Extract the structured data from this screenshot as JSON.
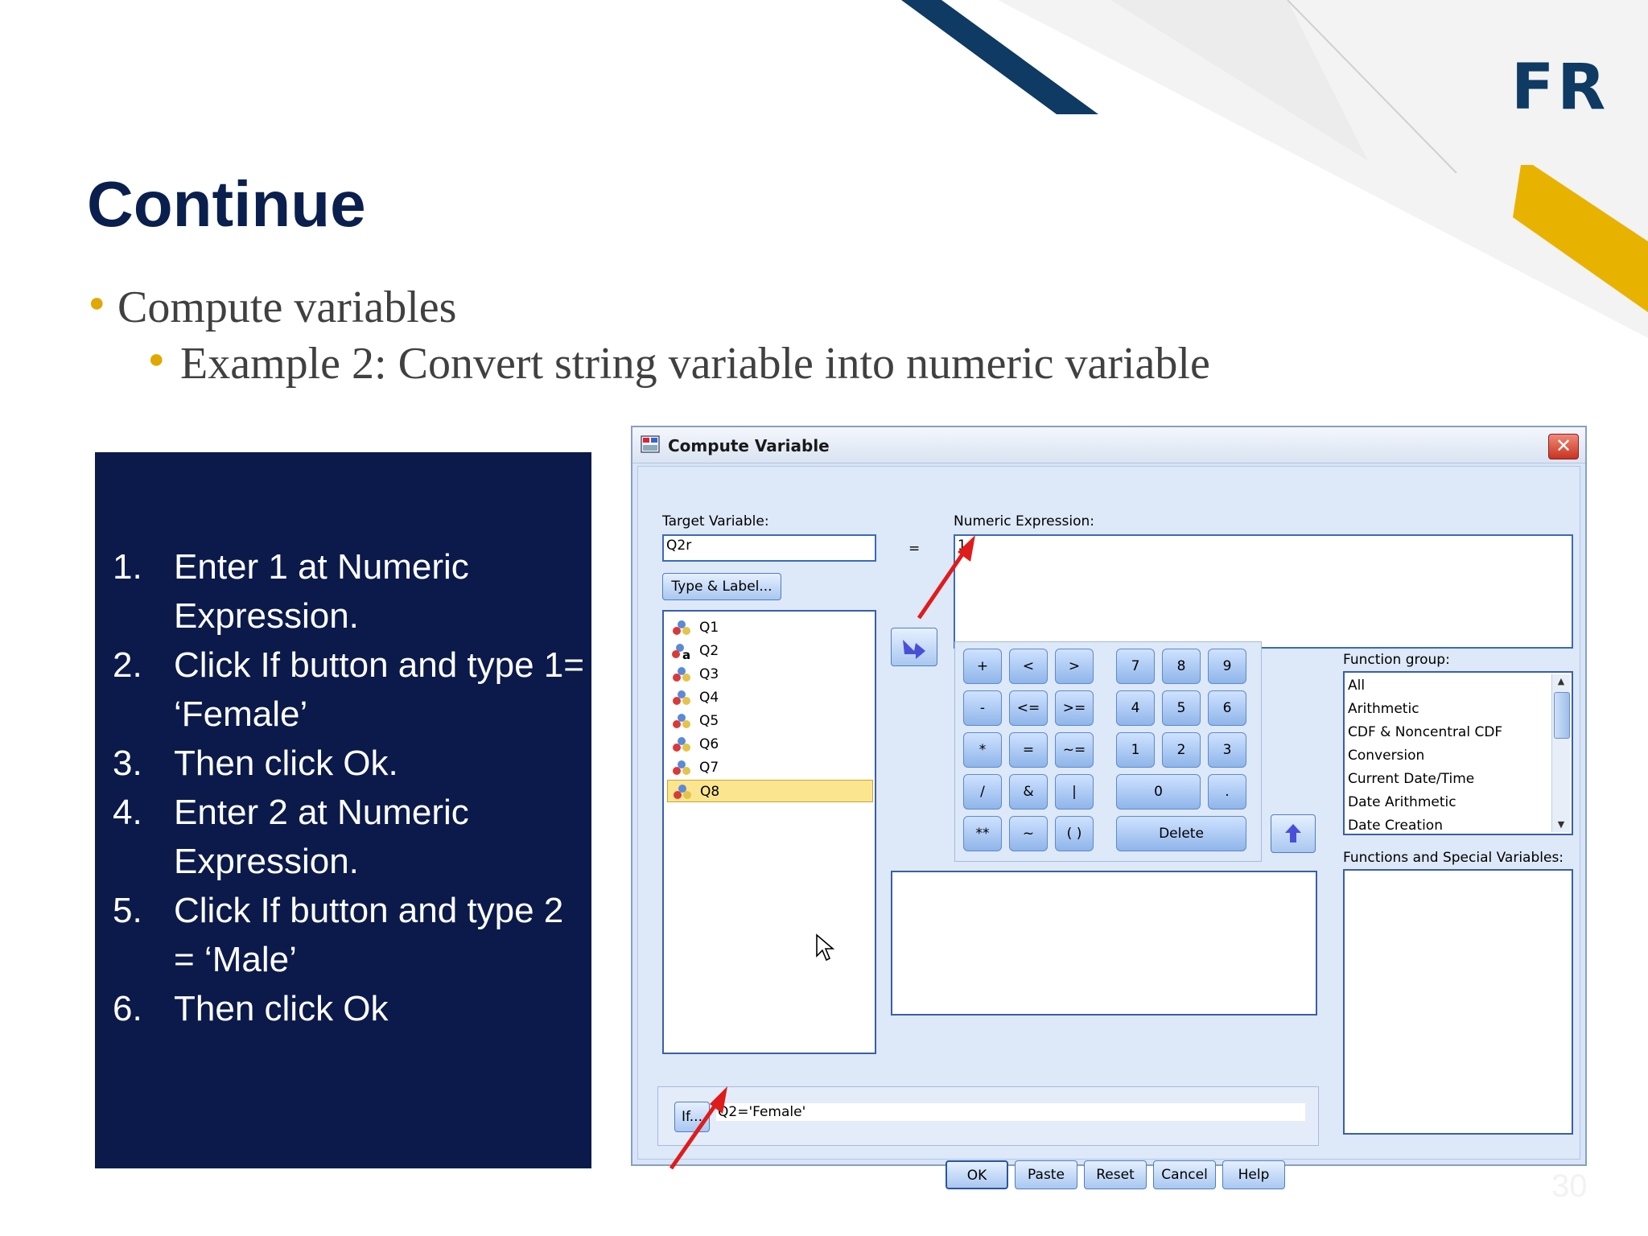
{
  "logo": "FR",
  "slide": {
    "title": "Continue",
    "bullet1": "Compute variables",
    "bullet2": "Example 2: Convert string variable into numeric variable",
    "page_number": "30"
  },
  "instructions": [
    {
      "num": "1.",
      "text": "Enter 1 at Numeric Expression."
    },
    {
      "num": "2.",
      "text": "Click If button and type 1= ‘Female’"
    },
    {
      "num": "3.",
      "text": "Then click Ok."
    },
    {
      "num": "4.",
      "text": "Enter 2 at Numeric Expression."
    },
    {
      "num": "5.",
      "text": "Click If button and type 2 = ‘Male’"
    },
    {
      "num": "6.",
      "text": "Then click Ok"
    }
  ],
  "dialog": {
    "title": "Compute Variable",
    "close": "✕",
    "target_label": "Target Variable:",
    "target_value": "Q2r",
    "equals": "=",
    "numeric_label": "Numeric Expression:",
    "numeric_value": "1",
    "type_label_button": "Type & Label...",
    "variables": [
      "Q1",
      "Q2",
      "Q3",
      "Q4",
      "Q5",
      "Q6",
      "Q7",
      "Q8"
    ],
    "selected_variable": "Q8",
    "keypad": {
      "plus": "+",
      "lt": "<",
      "gt": ">",
      "k7": "7",
      "k8": "8",
      "k9": "9",
      "minus": "-",
      "le": "<=",
      "ge": ">=",
      "k4": "4",
      "k5": "5",
      "k6": "6",
      "mul": "*",
      "eq": "=",
      "ne": "~=",
      "k1": "1",
      "k2": "2",
      "k3": "3",
      "div": "/",
      "and": "&",
      "or": "|",
      "k0": "0",
      "dot": ".",
      "pow": "**",
      "not": "~",
      "paren": "( )",
      "delete": "Delete"
    },
    "function_group_label": "Function group:",
    "function_groups": [
      "All",
      "Arithmetic",
      "CDF & Noncentral CDF",
      "Conversion",
      "Current Date/Time",
      "Date Arithmetic",
      "Date Creation"
    ],
    "functions_label": "Functions and Special Variables:",
    "if_button": "If...",
    "if_condition": "Q2='Female'",
    "buttons": {
      "ok": "OK",
      "paste": "Paste",
      "reset": "Reset",
      "cancel": "Cancel",
      "help": "Help"
    }
  },
  "colors": {
    "navy": "#0b1a4a",
    "accent_gold": "#e0a800",
    "logo": "#0e3a63",
    "annotation_arrow": "#e01b1b"
  }
}
